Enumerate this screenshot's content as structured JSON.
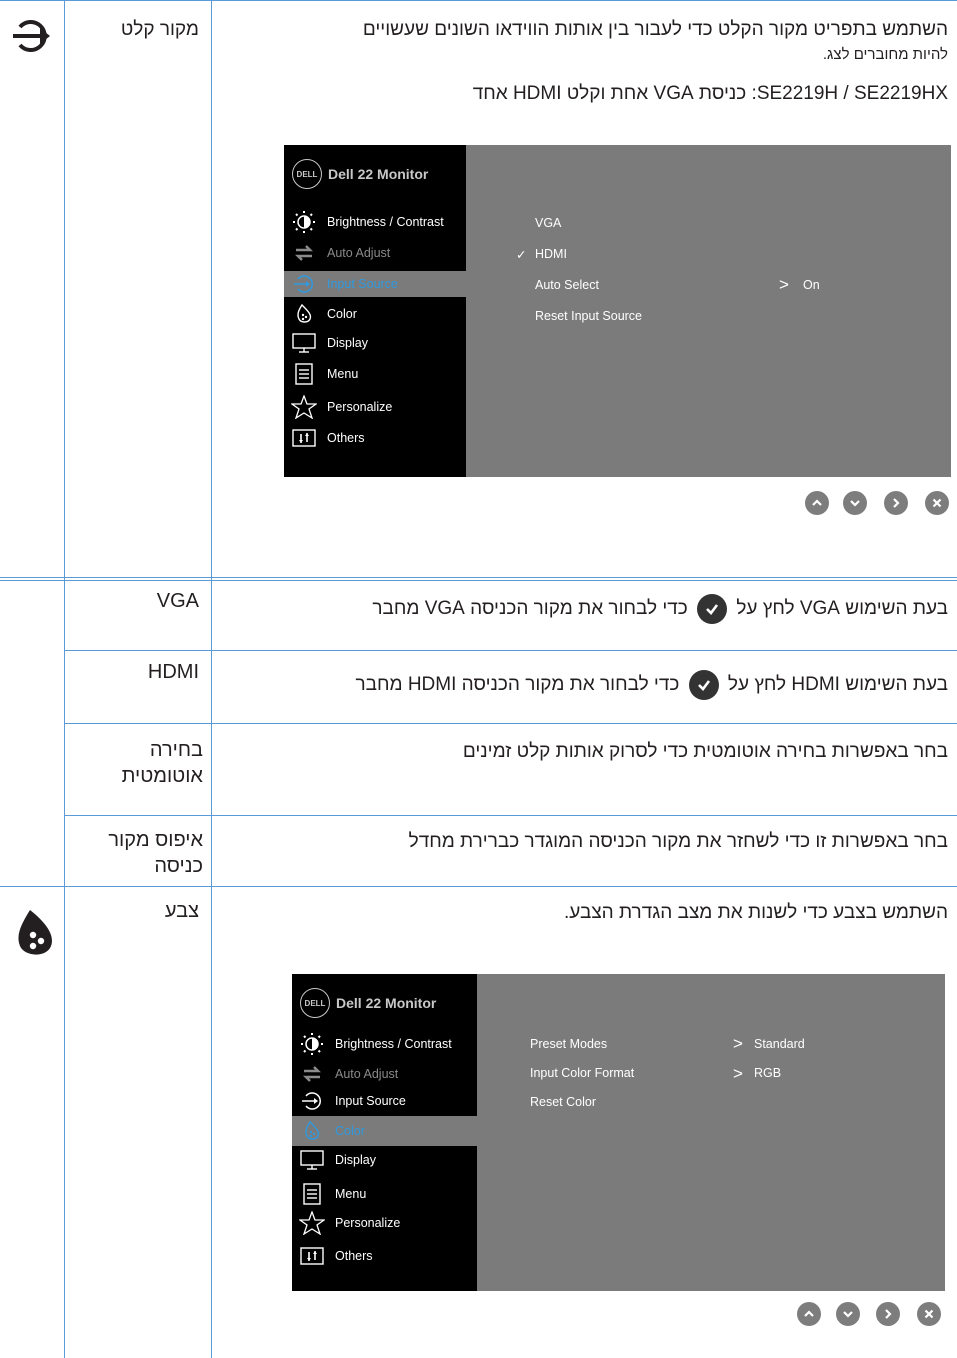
{
  "row1": {
    "label": "מקור קלט",
    "desc_line1": "השתמש בתפריט מקור הקלט כדי לעבור בין אותות הווידאו השונים שעשויים",
    "desc_line2": "להיות מחוברים לצג.",
    "models": "SE2219H / SE2219HX: כניסת VGA אחת וקלט HDMI אחד"
  },
  "osd1": {
    "title": "Dell 22 Monitor",
    "logo": "DELL",
    "menu": [
      "Brightness / Contrast",
      "Auto Adjust",
      "Input Source",
      "Color",
      "Display",
      "Menu",
      "Personalize",
      "Others"
    ],
    "options": [
      "VGA",
      "HDMI",
      "Auto Select",
      "Reset Input Source"
    ],
    "checkmark": "✓",
    "auto_select_value": "On",
    "arrow": ">"
  },
  "rows": [
    {
      "label": "VGA",
      "pre": "בעת השימוש VGA לחץ על",
      "post": "כדי לבחור את מקור הכניסה VGA מחבר"
    },
    {
      "label": "HDMI",
      "pre": "בעת השימוש HDMI לחץ על",
      "post": "כדי לבחור את מקור הכניסה HDMI מחבר"
    },
    {
      "label1": "בחירה",
      "label2": "אוטומטית",
      "desc": "בחר באפשרות בחירה אוטומטית כדי לסרוק אותות קלט זמינים"
    },
    {
      "label1": "איפוס מקור",
      "label2": "כניסה",
      "desc": "בחר באפשרות זו כדי לשחזר את מקור הכניסה המוגדר כברירת מחדל"
    }
  ],
  "row_color": {
    "label": "צבע",
    "desc": "השתמש בצבע כדי לשנות את מצב הגדרת הצבע."
  },
  "osd2": {
    "title": "Dell 22 Monitor",
    "logo": "DELL",
    "menu": [
      "Brightness / Contrast",
      "Auto Adjust",
      "Input Source",
      "Color",
      "Display",
      "Menu",
      "Personalize",
      "Others"
    ],
    "options": [
      "Preset Modes",
      "Input Color Format",
      "Reset Color"
    ],
    "values": [
      "Standard",
      "RGB"
    ],
    "arrow": ">"
  },
  "colors": {
    "rule": "#5b9bd5",
    "osd_left": "#000000",
    "osd_right": "#7b7b7b",
    "highlight": "#2f9ae0",
    "nav": "#7d7d7d"
  }
}
